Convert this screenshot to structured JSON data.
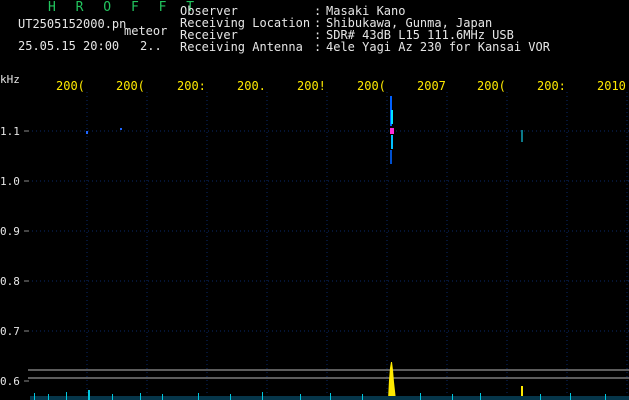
{
  "header": {
    "app_title": "H R O F F T",
    "filename": "UT2505152000.pn",
    "mode": "meteor",
    "datetime": "25.05.15 20:00",
    "span": "2..",
    "fields": [
      {
        "label": "Observer",
        "value": "Masaki Kano"
      },
      {
        "label": "Receiving Location",
        "value": "Shibukawa, Gunma, Japan"
      },
      {
        "label": "Receiver",
        "value": "SDR# 43dB L15 111.6MHz USB"
      },
      {
        "label": "Receiving Antenna",
        "value": "4ele Yagi Az 230 for Kansai VOR"
      }
    ]
  },
  "axis": {
    "y_unit": "kHz",
    "y_ticks": [
      "1.1",
      "1.0",
      "0.9",
      "0.8",
      "0.7",
      "0.6"
    ],
    "x_ticks": [
      "200(",
      "200(",
      "200:",
      "200.",
      "200!",
      "200(",
      "2007",
      "200(",
      "200:",
      "2010"
    ]
  },
  "colors": {
    "background": "#000000",
    "grid": "#0a2a6a",
    "signal_cyan": "#00e5ff",
    "signal_magenta": "#ff2bd6",
    "signal_yellow": "#ffea00",
    "reference_line": "#b8b8b8"
  }
}
